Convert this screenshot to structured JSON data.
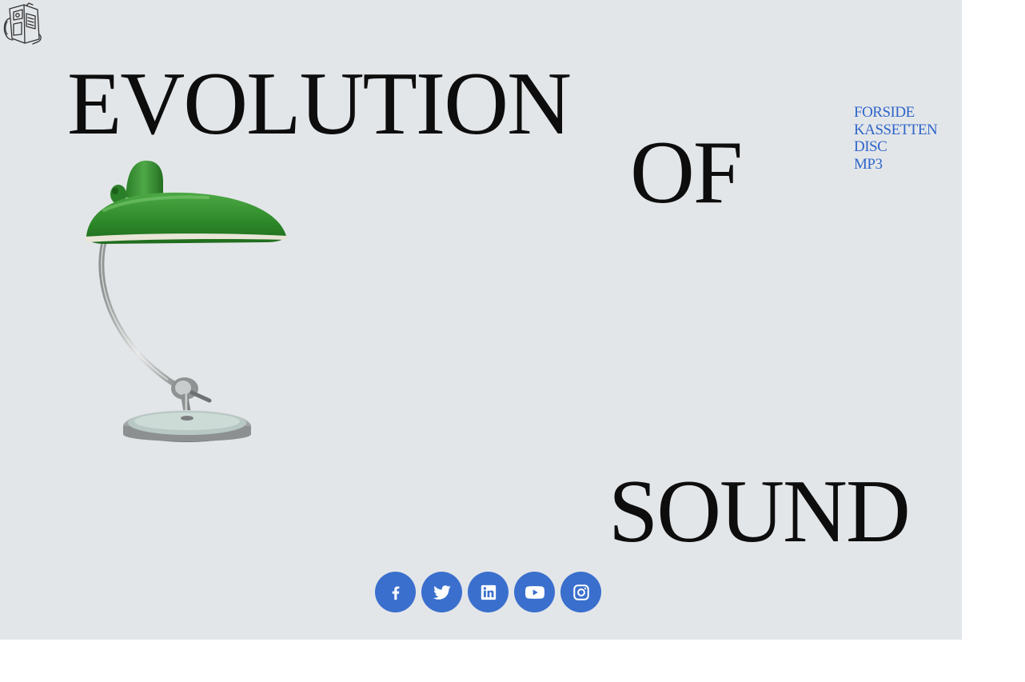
{
  "headline": {
    "word1": "EVOLUTION",
    "word2": "OF",
    "word3": "SOUND"
  },
  "nav": {
    "items": [
      {
        "label": "FORSIDE"
      },
      {
        "label": "KASSETTEN"
      },
      {
        "label": "DISC"
      },
      {
        "label": "MP3"
      }
    ]
  },
  "socials": [
    {
      "icon": "facebook-icon"
    },
    {
      "icon": "twitter-icon"
    },
    {
      "icon": "linkedin-icon"
    },
    {
      "icon": "youtube-icon"
    },
    {
      "icon": "instagram-icon"
    }
  ],
  "colors": {
    "page_background": "#e3e6e9",
    "headline_text": "#0d0d0d",
    "nav_link": "#2f66c9",
    "social_button": "#3a6fcd",
    "lamp_shade": "#2e8a2a"
  }
}
